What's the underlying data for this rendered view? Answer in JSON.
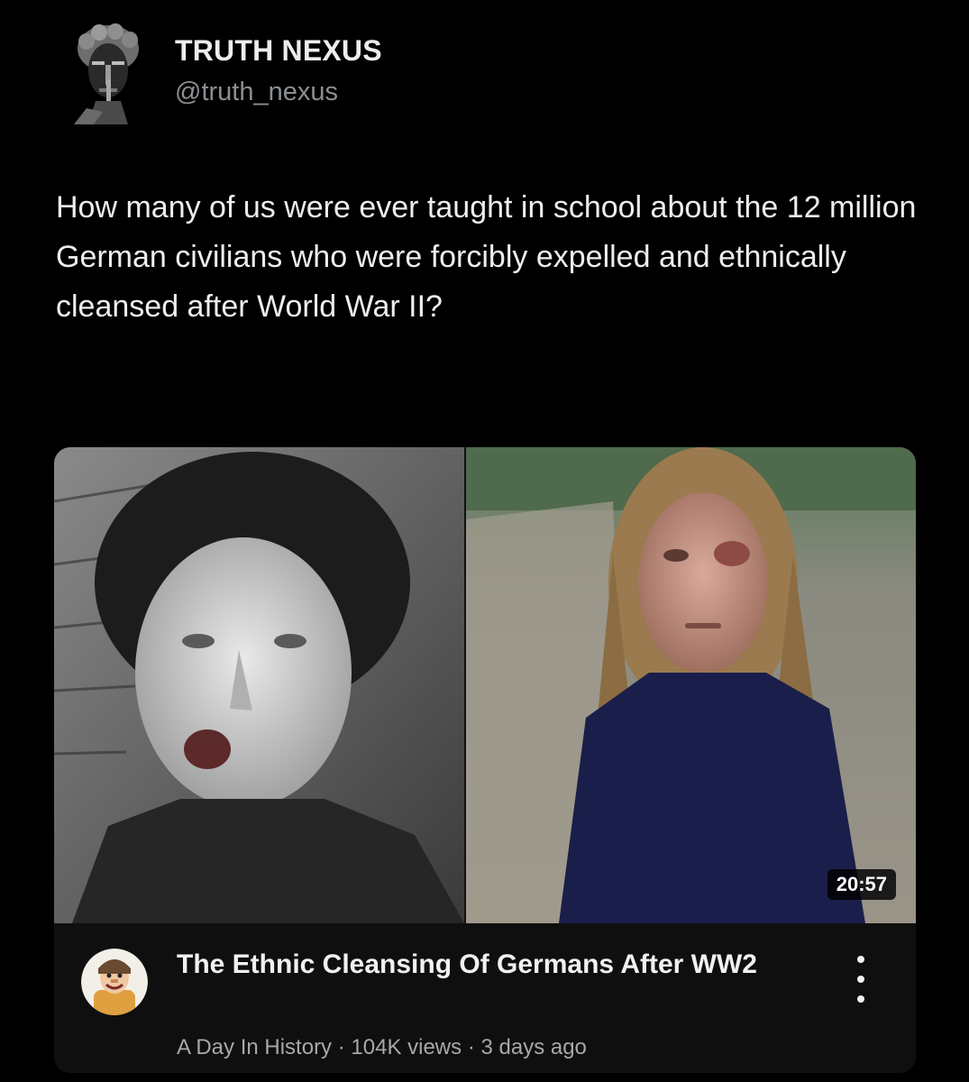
{
  "post": {
    "author_name": "TRUTH NEXUS",
    "author_handle": "@truth_nexus",
    "text": "How many of us were ever taught in school about the 12 million German civilians who were forcibly expelled and ethnically cleansed after World War II?"
  },
  "video": {
    "duration": "20:57",
    "title": "The Ethnic Cleansing Of Germans After WW2",
    "channel": "A Day In History",
    "separator": "·",
    "views": "104K views",
    "age": "3 days ago"
  },
  "icons": {
    "author_avatar": "statue-head-icon",
    "channel_avatar": "cartoon-character-icon",
    "more": "vertical-ellipsis-icon"
  },
  "colors": {
    "background": "#000000",
    "text_primary": "#ededed",
    "text_secondary": "#8b8f93",
    "card_background": "#0f0f0f"
  }
}
